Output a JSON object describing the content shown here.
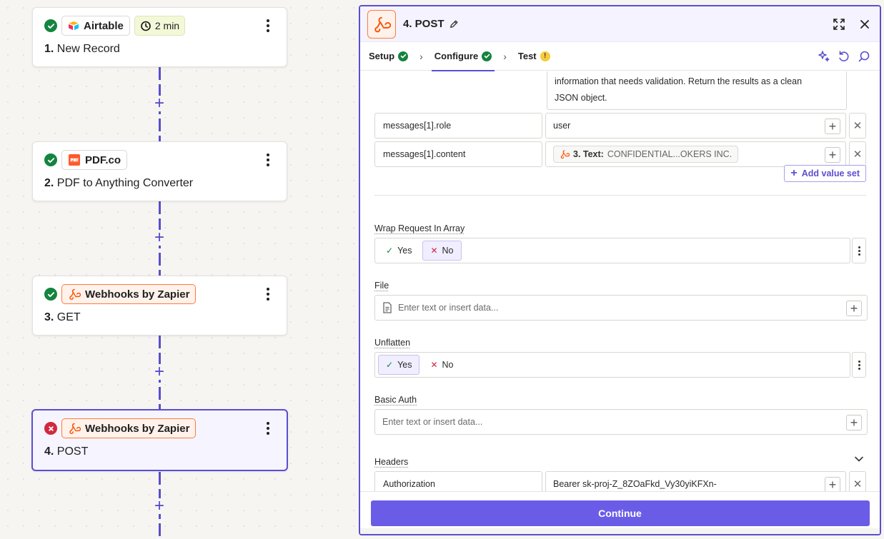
{
  "workflow": {
    "steps": [
      {
        "number": "1.",
        "name": "New Record",
        "app": "Airtable",
        "time": "2 min",
        "status": "ok"
      },
      {
        "number": "2.",
        "name": "PDF to Anything Converter",
        "app": "PDF.co",
        "status": "ok"
      },
      {
        "number": "3.",
        "name": "GET",
        "app": "Webhooks by Zapier",
        "status": "ok"
      },
      {
        "number": "4.",
        "name": "POST",
        "app": "Webhooks by Zapier",
        "status": "error"
      }
    ],
    "add_symbol": "+"
  },
  "panel": {
    "title": "4. POST",
    "tabs": [
      {
        "label": "Setup",
        "state": "ok"
      },
      {
        "label": "Configure",
        "state": "ok"
      },
      {
        "label": "Test",
        "state": "warn"
      }
    ],
    "tab_separator": "›",
    "prompt_tail_line1": "information that needs validation. Return the results as a clean",
    "prompt_tail_line2": "JSON object.",
    "rows": [
      {
        "key": "messages[1].role",
        "value": "user"
      },
      {
        "key": "messages[1].content",
        "pill_label": "3. Text:",
        "pill_value": "CONFIDENTIAL...OKERS INC."
      }
    ],
    "add_value_set": "Add value set",
    "wrap_request": {
      "label": "Wrap Request In Array",
      "yes": "Yes",
      "no": "No",
      "selected": "No"
    },
    "file": {
      "label": "File",
      "placeholder": "Enter text or insert data..."
    },
    "unflatten": {
      "label": "Unflatten",
      "yes": "Yes",
      "no": "No",
      "selected": "Yes"
    },
    "basic_auth": {
      "label": "Basic Auth",
      "placeholder": "Enter text or insert data..."
    },
    "headers": {
      "label": "Headers",
      "key": "Authorization",
      "value": "Bearer sk-proj-Z_8ZOaFkd_Vy30yiKFXn-"
    },
    "continue_label": "Continue"
  },
  "colors": {
    "accent": "#5a4fd0",
    "success": "#14843f",
    "error": "#d1283f",
    "webhook": "#ff7a3d",
    "button": "#6b5ce7"
  },
  "icons": [
    "check-icon",
    "error-x-icon",
    "airtable-logo",
    "stopwatch-icon",
    "pdfco-logo",
    "webhook-icon",
    "pencil-icon",
    "expand-icon",
    "close-icon",
    "sparkle-icon",
    "undo-icon",
    "search-icon",
    "chevron-down-icon",
    "document-icon"
  ]
}
